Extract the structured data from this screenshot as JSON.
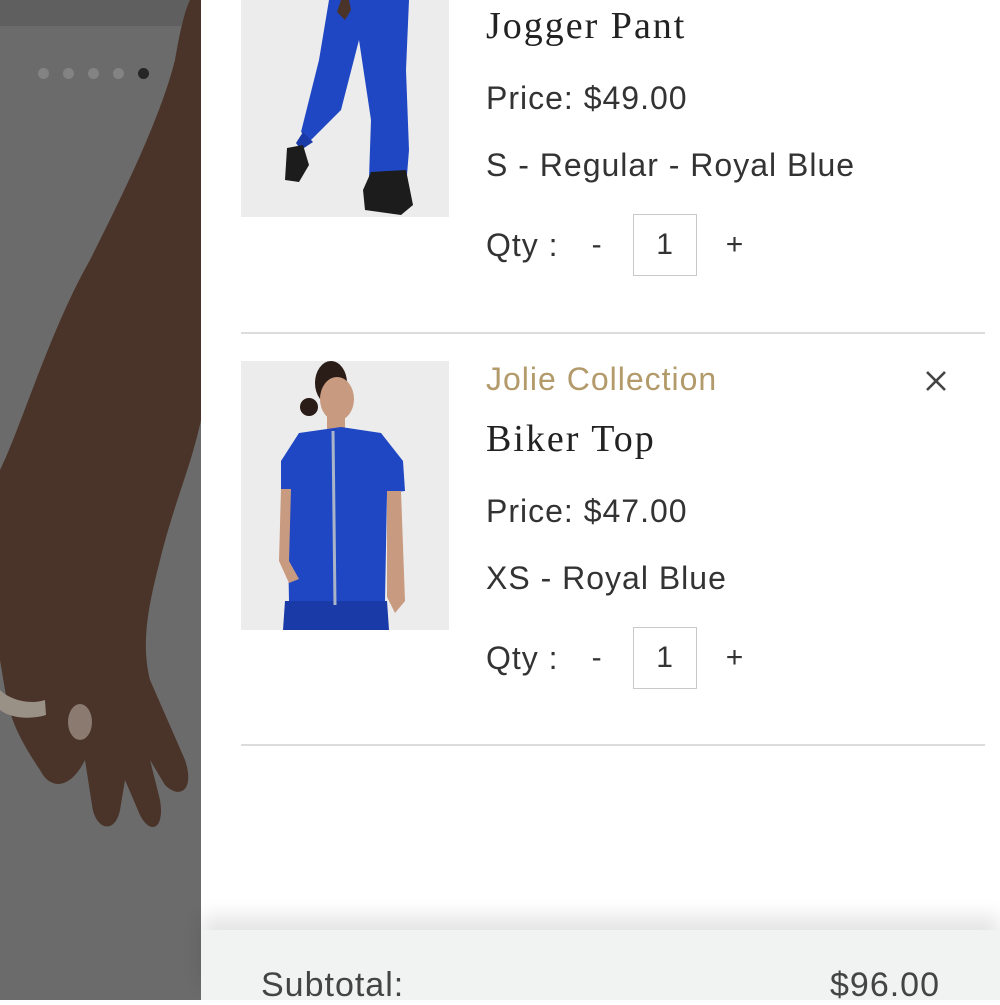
{
  "carousel": {
    "dot_count": 5,
    "active_index": 4
  },
  "cart": {
    "items": [
      {
        "brand": "",
        "name": "Jogger Pant",
        "price": "Price: $49.00",
        "variant": "S - Regular - Royal Blue",
        "qty_label": "Qty :",
        "qty_minus": "-",
        "qty_value": "1",
        "qty_plus": "+"
      },
      {
        "brand": "Jolie Collection",
        "name": "Biker Top",
        "price": "Price: $47.00",
        "variant": "XS - Royal Blue",
        "qty_label": "Qty :",
        "qty_minus": "-",
        "qty_value": "1",
        "qty_plus": "+",
        "remove_icon": "close-icon"
      }
    ]
  },
  "footer": {
    "subtotal_label": "Subtotal:",
    "subtotal_value": "$96.00"
  },
  "colors": {
    "brand_gold": "#b39a6a",
    "royal_blue": "#1f47c4",
    "overlay": "#6b6b6b",
    "footer_bg": "#f1f2f2"
  }
}
